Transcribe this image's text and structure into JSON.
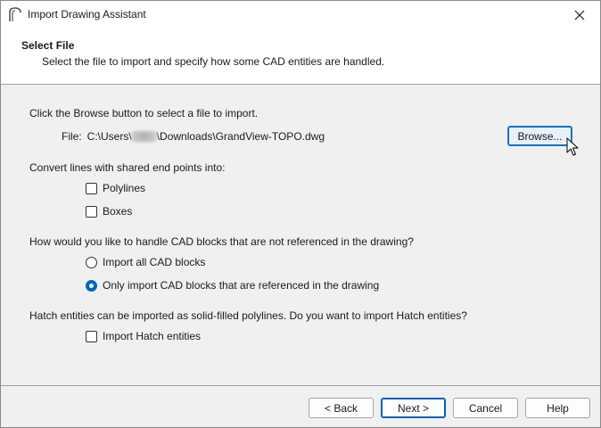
{
  "window": {
    "title": "Import Drawing Assistant"
  },
  "header": {
    "title": "Select File",
    "subtitle": "Select the file to import and specify how some CAD entities are handled."
  },
  "browse": {
    "instruction": "Click the Browse button to select a file to import.",
    "file_label": "File:",
    "path_prefix": "C:\\Users\\",
    "path_suffix": "\\Downloads\\GrandView-TOPO.dwg",
    "button_label": "Browse..."
  },
  "lines": {
    "question": "Convert lines with shared end points into:",
    "options": [
      {
        "label": "Polylines",
        "checked": false
      },
      {
        "label": "Boxes",
        "checked": false
      }
    ]
  },
  "blocks": {
    "question": "How would you like to handle CAD blocks that are not referenced in the drawing?",
    "options": [
      {
        "label": "Import all CAD blocks",
        "selected": false
      },
      {
        "label": "Only import CAD blocks that are referenced in the drawing",
        "selected": true
      }
    ]
  },
  "hatch": {
    "question": "Hatch entities can be imported as solid-filled polylines. Do you want to import Hatch entities?",
    "option": {
      "label": "Import Hatch entities",
      "checked": false
    }
  },
  "footer": {
    "back_label": "< Back",
    "next_label": "Next >",
    "cancel_label": "Cancel",
    "help_label": "Help"
  },
  "colors": {
    "accent": "#0067c0",
    "focus_border": "#0060c0"
  }
}
